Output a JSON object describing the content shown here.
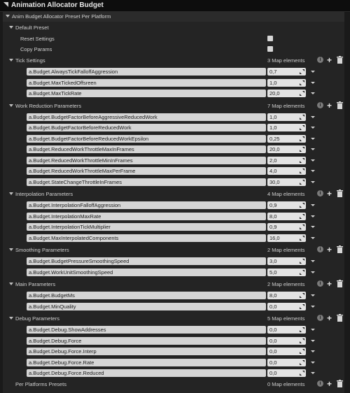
{
  "header": {
    "title": "Animation Allocator Budget"
  },
  "root": {
    "label": "Anim Budget Allocator Preset Per Platform"
  },
  "default_preset": {
    "label": "Default Preset"
  },
  "reset_settings": {
    "label": "Reset Settings",
    "checked": false
  },
  "copy_params": {
    "label": "Copy Params",
    "checked": false
  },
  "info_glyph": "i",
  "plus_glyph": "+",
  "sections": [
    {
      "title": "Tick Settings",
      "count_text": "3 Map elements",
      "entries": [
        {
          "key": "a.Budget.AlwaysTickFalloffAggression",
          "value": "0,7"
        },
        {
          "key": "a.Budget.MaxTickedOffsreen",
          "value": "1,0"
        },
        {
          "key": "a.Budget.MaxTickRate",
          "value": "20,0"
        }
      ]
    },
    {
      "title": "Work Reduction Parameters",
      "count_text": "7 Map elements",
      "entries": [
        {
          "key": "a.Budget.BudgetFactorBeforeAggressiveReducedWork",
          "value": "1,0"
        },
        {
          "key": "a.Budget.BudgetFactorBeforeReducedWork",
          "value": "1,0"
        },
        {
          "key": "a.Budget.BudgetFactorBeforeReducedWorkEpsilon",
          "value": "0,25"
        },
        {
          "key": "a.Budget.ReducedWorkThrottleMaxInFrames",
          "value": "20,0"
        },
        {
          "key": "a.Budget.ReducedWorkThrottleMinInFrames",
          "value": "2,0"
        },
        {
          "key": "a.Budget.ReducedWorkThrottleMaxPerFrame",
          "value": "4,0"
        },
        {
          "key": "a.Budget.StateChangeThrottleInFrames",
          "value": "30,0"
        }
      ]
    },
    {
      "title": "Interpolation Parameters",
      "count_text": "4 Map elements",
      "entries": [
        {
          "key": "a.Budget.InterpolationFalloffAggression",
          "value": "0,9"
        },
        {
          "key": "a.Budget.InterpolationMaxRate",
          "value": "8,0"
        },
        {
          "key": "a.Budget.InterpolationTickMultiplier",
          "value": "0,9"
        },
        {
          "key": "a.Budget.MaxInterpolatedComponents",
          "value": "16,0"
        }
      ]
    },
    {
      "title": "Smoothing Parameters",
      "count_text": "2 Map elements",
      "entries": [
        {
          "key": "a.Budget.BudgetPressureSmoothingSpeed",
          "value": "3,0"
        },
        {
          "key": "a.Budget.WorkUnitSmoothingSpeed",
          "value": "5,0"
        }
      ]
    },
    {
      "title": "Main Parameters",
      "count_text": "2 Map elements",
      "entries": [
        {
          "key": "a.Budget.BudgetMs",
          "value": "8,0"
        },
        {
          "key": "a.Budget.MinQuality",
          "value": "0,0"
        }
      ]
    },
    {
      "title": "Debug Parameters",
      "count_text": "5 Map elements",
      "entries": [
        {
          "key": "a.Budget.Debug.ShowAddresses",
          "value": "0,0"
        },
        {
          "key": "a.Budget.Debug.Force",
          "value": "0,0"
        },
        {
          "key": "a.Budget.Debug.Force.Interp",
          "value": "0,0"
        },
        {
          "key": "a.Budget.Debug.Force.Rate",
          "value": "0,0"
        },
        {
          "key": "a.Budget.Debug.Force.Reduced",
          "value": "0,0"
        }
      ]
    }
  ],
  "per_platforms": {
    "label": "Per Platforms Presets",
    "count_text": "0 Map elements"
  }
}
